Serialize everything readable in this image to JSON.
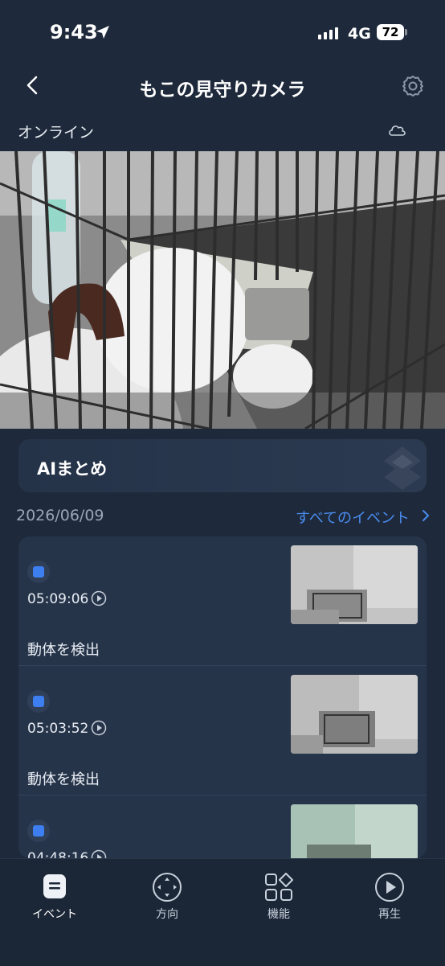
{
  "status_bar": {
    "time": "9:43",
    "network": "4G",
    "battery": "72"
  },
  "header": {
    "title": "もこの見守りカメラ"
  },
  "connection": {
    "status": "オンライン"
  },
  "ai_summary": {
    "label": "AIまとめ"
  },
  "events": {
    "date": "2026/06/09",
    "all_link": "すべてのイベント",
    "items": [
      {
        "time": "05:09:06",
        "label": "動体を検出"
      },
      {
        "time": "05:03:52",
        "label": "動体を検出"
      },
      {
        "time": "04:48:16",
        "label": ""
      }
    ]
  },
  "tabs": [
    {
      "label": "イベント",
      "icon": "events-icon",
      "active": true
    },
    {
      "label": "方向",
      "icon": "direction-pad-icon"
    },
    {
      "label": "機能",
      "icon": "features-grid-icon"
    },
    {
      "label": "再生",
      "icon": "playback-icon"
    }
  ],
  "colors": {
    "background": "#1e2a3b",
    "accent": "#4a8cf0",
    "event_badge": "#3d7ef0"
  }
}
